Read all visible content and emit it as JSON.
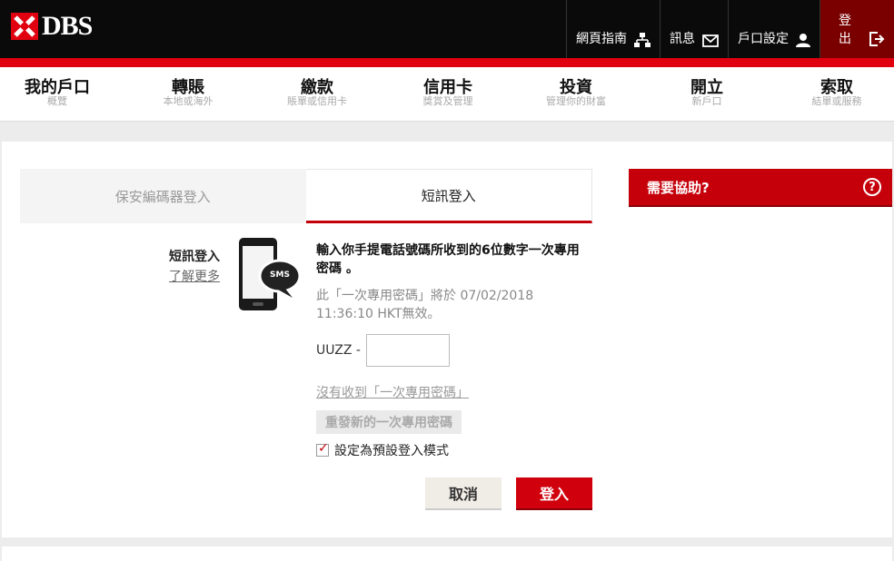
{
  "brand": {
    "name": "DBS",
    "color": "#e0000f"
  },
  "top_nav": [
    {
      "label": "網頁指南",
      "icon": "sitemap-icon"
    },
    {
      "label": "訊息",
      "icon": "mail-icon"
    },
    {
      "label": "戶口設定",
      "icon": "user-icon"
    },
    {
      "label": "登出",
      "icon": "logout-icon"
    }
  ],
  "main_nav": [
    {
      "title": "我的戶口",
      "sub": "概覽"
    },
    {
      "title": "轉賬",
      "sub": "本地或海外"
    },
    {
      "title": "繳款",
      "sub": "賬單或信用卡"
    },
    {
      "title": "信用卡",
      "sub": "獎賞及管理"
    },
    {
      "title": "投資",
      "sub": "管理你的財富"
    },
    {
      "title": "開立",
      "sub": "新戶口"
    },
    {
      "title": "索取",
      "sub": "結單或服務"
    }
  ],
  "tabs": {
    "token": "保安編碼器登入",
    "sms": "短訊登入"
  },
  "side": {
    "title": "短訊登入",
    "link": "了解更多"
  },
  "phone_badge": "SMS",
  "form": {
    "instruction": "輸入你手提電話號碼所收到的6位數字一次專用密碼 。",
    "expiry": "此「一次專用密碼」將於 07/02/2018 11:36:10 HKT無效。",
    "otp_prefix": "UUZZ -",
    "otp_value": "",
    "no_receive": "沒有收到「一次專用密碼」",
    "resend": "重發新的一次專用密碼",
    "default_label": "設定為預設登入模式",
    "default_checked": true
  },
  "buttons": {
    "cancel": "取消",
    "login": "登入"
  },
  "help": {
    "label": "需要協助?",
    "icon": "question-icon"
  }
}
